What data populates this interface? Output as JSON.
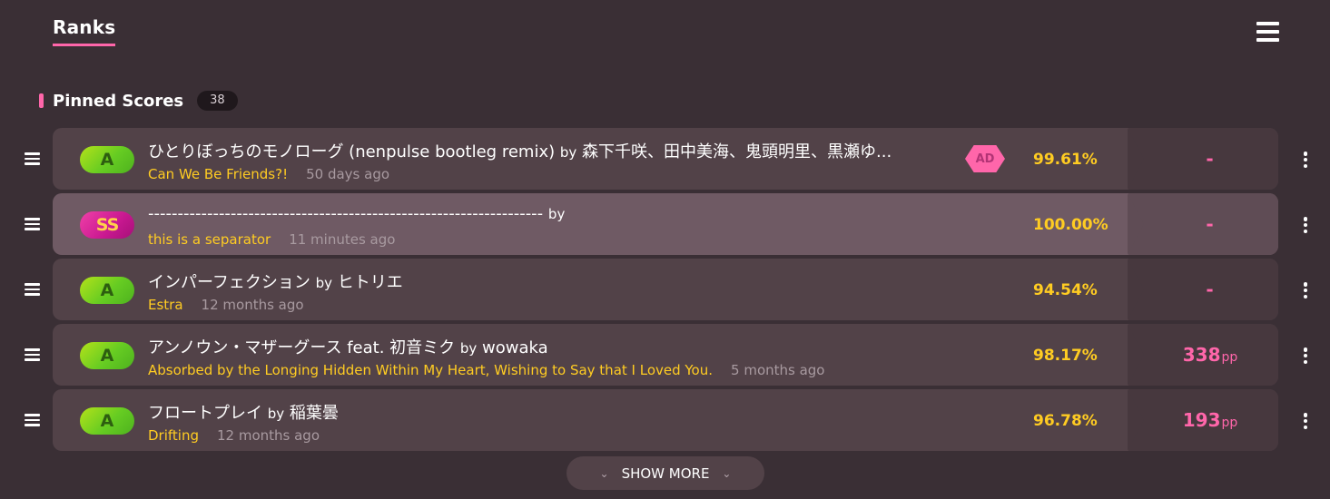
{
  "tabs": {
    "ranks": "Ranks"
  },
  "section": {
    "title": "Pinned Scores",
    "count": "38"
  },
  "scores": [
    {
      "grade": "A",
      "title": "ひとりぼっちのモノローグ (nenpulse bootleg remix)",
      "by": "by",
      "artist": "森下千咲、田中美海、鬼頭明里、黒瀬ゆ...",
      "difficulty": "Can We Be Friends?!",
      "ago": "50 days ago",
      "mod": "AD",
      "accuracy": "99.61%",
      "pp": "-",
      "pp_unit": ""
    },
    {
      "grade": "SS",
      "title": "-------------------------------------------------------------------",
      "by": "by",
      "artist": "",
      "difficulty": "this is a separator",
      "ago": "11 minutes ago",
      "mod": "",
      "accuracy": "100.00%",
      "pp": "-",
      "pp_unit": ""
    },
    {
      "grade": "A",
      "title": "インパーフェクション",
      "by": "by",
      "artist": "ヒトリエ",
      "difficulty": "Estra",
      "ago": "12 months ago",
      "mod": "",
      "accuracy": "94.54%",
      "pp": "-",
      "pp_unit": ""
    },
    {
      "grade": "A",
      "title": "アンノウン・マザーグース feat. 初音ミク",
      "by": "by",
      "artist": "wowaka",
      "difficulty": "Absorbed by the Longing Hidden Within My Heart, Wishing to Say that I Loved You.",
      "ago": "5 months ago",
      "mod": "",
      "accuracy": "98.17%",
      "pp": "338",
      "pp_unit": "pp"
    },
    {
      "grade": "A",
      "title": "フロートプレイ",
      "by": "by",
      "artist": "稲葉曇",
      "difficulty": "Drifting",
      "ago": "12 months ago",
      "mod": "",
      "accuracy": "96.78%",
      "pp": "193",
      "pp_unit": "pp"
    }
  ],
  "show_more": {
    "label": "SHOW MORE"
  },
  "icons": {
    "menu": "hamburger-menu-icon",
    "drag": "drag-handle-icon",
    "options": "kebab-menu-icon",
    "chevron": "chevron-down-icon"
  },
  "colors": {
    "accent": "#ff66aa",
    "accuracy": "#ffcc22",
    "difficulty": "#ffcc22",
    "background": "#3a2f35",
    "card": "#524248"
  }
}
